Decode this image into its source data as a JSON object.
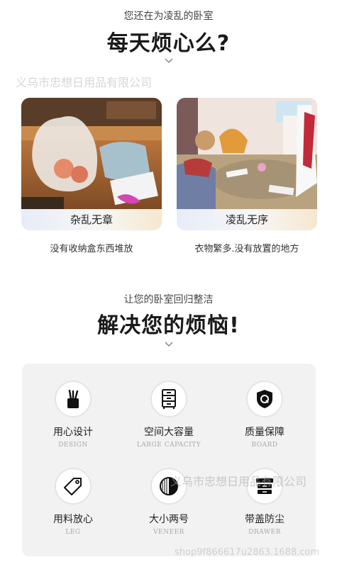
{
  "intro": {
    "subtitle": "您还在为凌乱的卧室",
    "headline": "每天烦心么?"
  },
  "watermarks": {
    "top": "义乌市忠想日用品有限公司",
    "middle": "义乌市忠想日用品有限公司",
    "bottom": "shop9f866617u2863.1688.com"
  },
  "cards": [
    {
      "label": "杂乱无章",
      "caption": "没有收纳盒东西堆放"
    },
    {
      "label": "凌乱无序",
      "caption": "衣物繁多.没有放置的地方"
    }
  ],
  "solution": {
    "subtitle": "让您的卧室回归整洁",
    "headline": "解决您的烦恼!"
  },
  "features": [
    {
      "zh": "用心设计",
      "en": "DESIGN",
      "icon": "pen-holder-icon"
    },
    {
      "zh": "空间大容量",
      "en": "LARGE CAPACITY",
      "icon": "drawer-cabinet-icon"
    },
    {
      "zh": "质量保障",
      "en": "BOARD",
      "icon": "shield-q-icon"
    },
    {
      "zh": "用料放心",
      "en": "LEG",
      "icon": "tag-icon"
    },
    {
      "zh": "大小两号",
      "en": "VENEER",
      "icon": "half-circle-icon"
    },
    {
      "zh": "带盖防尘",
      "en": "DRAWER",
      "icon": "lidded-box-icon"
    }
  ],
  "colors": {
    "accent_dark": "#1a1a1a",
    "panel_bg": "#f2f2f2"
  }
}
